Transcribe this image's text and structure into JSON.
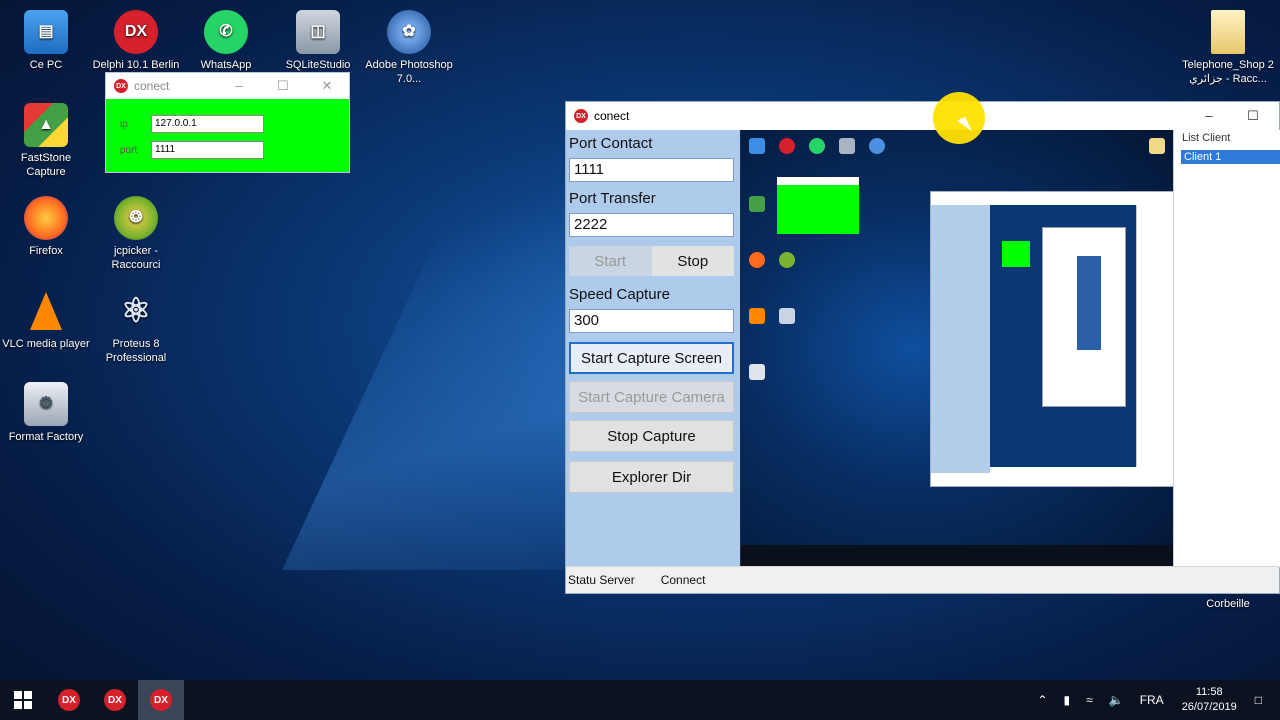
{
  "desktop": {
    "icons": [
      {
        "label": "Ce PC"
      },
      {
        "label": "Delphi 10.1 Berlin"
      },
      {
        "label": "WhatsApp"
      },
      {
        "label": "SQLiteStudio"
      },
      {
        "label": "Adobe Photoshop 7.0..."
      },
      {
        "label": "FastStone Capture"
      },
      {
        "label": "Firefox"
      },
      {
        "label": "jcpicker - Raccourci"
      },
      {
        "label": "VLC media player"
      },
      {
        "label": "Proteus 8 Professional"
      },
      {
        "label": "Format Factory"
      },
      {
        "label": "Telephone_Shop 2 جزائري - Racc..."
      },
      {
        "label": "Corbeille"
      }
    ]
  },
  "small_window": {
    "title": "conect",
    "ip_label": "ip",
    "ip_value": "127.0.0.1",
    "port_label": "port",
    "port_value": "1111",
    "bg_color": "#00ff00"
  },
  "main_window": {
    "title": "conect",
    "port_contact_label": "Port Contact",
    "port_contact_value": "1111",
    "port_transfer_label": "Port Transfer",
    "port_transfer_value": "2222",
    "start_label": "Start",
    "stop_label": "Stop",
    "speed_label": "Speed Capture",
    "speed_value": "300",
    "btn_capture_screen": "Start Capture Screen",
    "btn_capture_camera": "Start Capture Camera",
    "btn_stop_capture": "Stop Capture",
    "btn_explorer": "Explorer Dir",
    "list_title": "List Client",
    "list_items": [
      "Client 1"
    ],
    "status_server": "Statu Server",
    "status_connect": "Connect"
  },
  "taskbar": {
    "language": "FRA",
    "time": "11:58",
    "date": "26/07/2019"
  },
  "colors": {
    "accent": "#2f7ad9",
    "left_panel": "#aecbeb",
    "delphi_red": "#d6202b"
  }
}
